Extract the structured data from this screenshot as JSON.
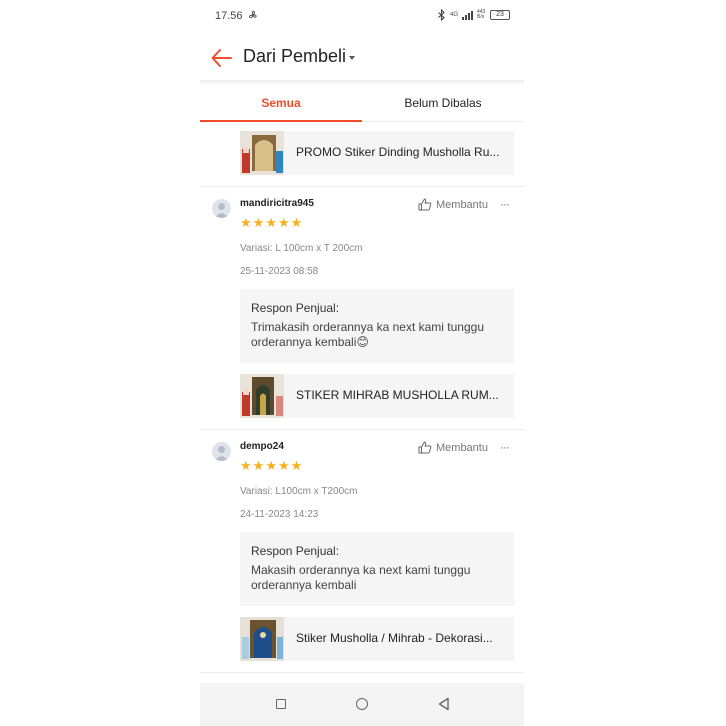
{
  "status_bar": {
    "time": "17.56",
    "network": "4G",
    "speed": "443 B/s",
    "battery": "23"
  },
  "header": {
    "title": "Dari Pembeli"
  },
  "tabs": [
    {
      "label": "Semua",
      "active": true
    },
    {
      "label": "Belum Dibalas",
      "active": false
    }
  ],
  "top_product": {
    "name": "PROMO Stiker Dinding Musholla Ru..."
  },
  "reviews": [
    {
      "username": "mandiricitra945",
      "helpful_label": "Membantu",
      "rating": 5,
      "variation": "Variasi: L 100cm x T 200cm",
      "timestamp": "25-11-2023 08:58",
      "reply_label": "Respon Penjual:",
      "reply_text": "Trimakasih orderannya ka next kami tunggu orderannya kembali😊",
      "product_name": "STIKER MIHRAB MUSHOLLA RUM..."
    },
    {
      "username": "dempo24",
      "helpful_label": "Membantu",
      "rating": 5,
      "variation": "Variasi: L100cm x T200cm",
      "timestamp": "24-11-2023 14:23",
      "reply_label": "Respon Penjual:",
      "reply_text": "Makasih orderannya ka next kami tunggu orderannya kembali",
      "product_name": "Stiker Musholla / Mihrab - Dekorasi..."
    }
  ],
  "colors": {
    "accent": "#ee4d2d",
    "star": "#f6b01e",
    "panel": "#f5f5f5"
  }
}
